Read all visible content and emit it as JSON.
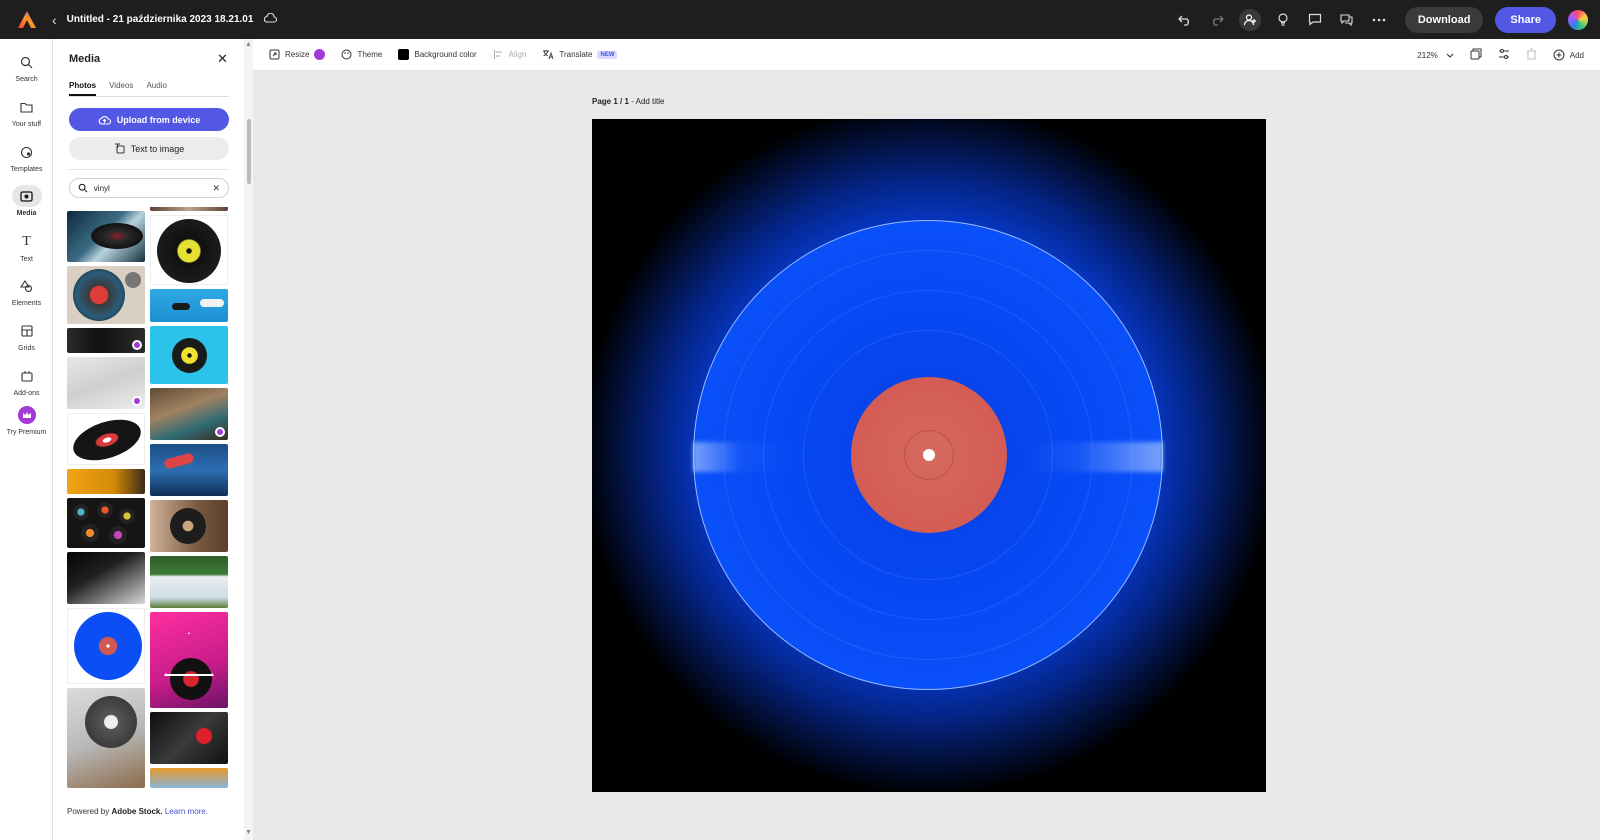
{
  "topbar": {
    "document_title": "Untitled - 21 października 2023 18.21.01",
    "download_label": "Download",
    "share_label": "Share"
  },
  "rail": {
    "items": [
      {
        "label": "Search"
      },
      {
        "label": "Your stuff"
      },
      {
        "label": "Templates"
      },
      {
        "label": "Media"
      },
      {
        "label": "Text"
      },
      {
        "label": "Elements"
      },
      {
        "label": "Grids"
      },
      {
        "label": "Add-ons"
      },
      {
        "label": "Try Premium"
      }
    ]
  },
  "panel": {
    "title": "Media",
    "tabs": [
      "Photos",
      "Videos",
      "Audio"
    ],
    "upload_label": "Upload from device",
    "text_to_image_label": "Text to image",
    "search_value": "vinyl",
    "powered_prefix": "Powered by",
    "powered_brand": "Adobe Stock.",
    "learn_more": "Learn more."
  },
  "toolbar": {
    "resize": "Resize",
    "theme": "Theme",
    "background_color": "Background color",
    "align": "Align",
    "translate": "Translate",
    "new_badge": "NEW",
    "zoom": "212%",
    "add": "Add"
  },
  "canvas": {
    "page_indicator": "Page 1 / 1",
    "page_title_placeholder": "- Add title"
  },
  "colors": {
    "accent": "#5258e4",
    "premium": "#a13ad6",
    "topbar_bg": "#1e1e1e",
    "vinyl_blue": "#0b4ff4",
    "label_red": "#d2574f"
  }
}
